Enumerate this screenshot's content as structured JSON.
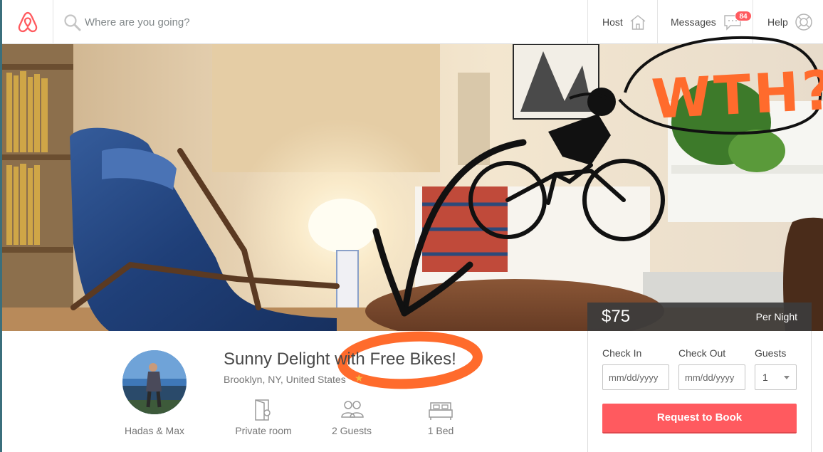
{
  "header": {
    "search_placeholder": "Where are you going?",
    "host_label": "Host",
    "messages_label": "Messages",
    "messages_count": "84",
    "help_label": "Help"
  },
  "hero": {
    "annotation_text": "WTH?"
  },
  "booking": {
    "price": "$75",
    "price_unit": "Per Night",
    "check_in_label": "Check In",
    "check_out_label": "Check Out",
    "guests_label": "Guests",
    "check_in_placeholder": "mm/dd/yyyy",
    "check_out_placeholder": "mm/dd/yyyy",
    "guests_value": "1",
    "request_label": "Request to Book"
  },
  "listing": {
    "host_name": "Hadas & Max",
    "title": "Sunny Delight with Free Bikes!",
    "location": "Brooklyn, NY, United States",
    "amenities": [
      {
        "icon": "private-room-icon",
        "label": "Private room"
      },
      {
        "icon": "guests-icon",
        "label": "2 Guests"
      },
      {
        "icon": "bed-icon",
        "label": "1 Bed"
      }
    ]
  },
  "colors": {
    "brand": "#ff5a5f",
    "annotation_orange": "#ff6b2c",
    "doodle_black": "#111111"
  }
}
